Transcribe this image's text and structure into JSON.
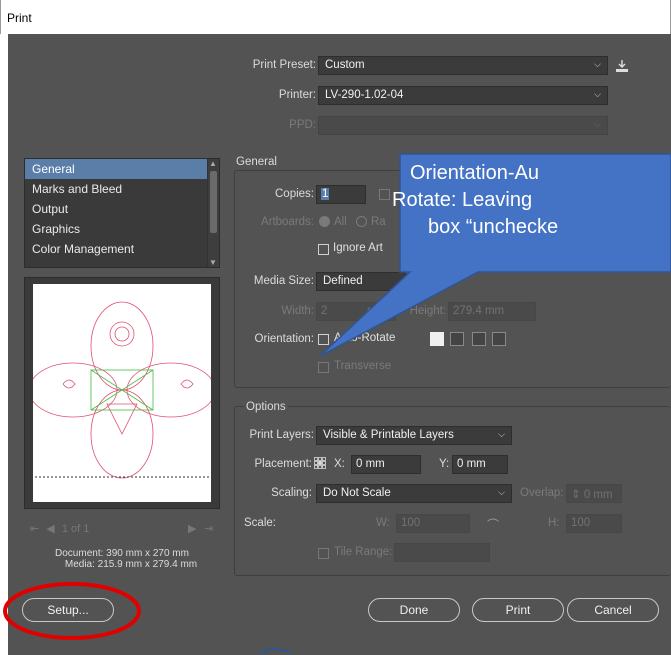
{
  "window": {
    "title": "Print"
  },
  "print_preset": {
    "label": "Print Preset:",
    "value": "Custom"
  },
  "printer": {
    "label": "Printer:",
    "value": "LV-290-1.02-04"
  },
  "ppd": {
    "label": "PPD:",
    "value": ""
  },
  "sidebar": {
    "items": [
      {
        "label": "General"
      },
      {
        "label": "Marks and Bleed"
      },
      {
        "label": "Output"
      },
      {
        "label": "Graphics"
      },
      {
        "label": "Color Management"
      }
    ]
  },
  "general": {
    "title": "General",
    "copies_label": "Copies:",
    "copies_value": "1",
    "artboards_label": "Artboards:",
    "all_label": "All",
    "range_label": "Ra",
    "ignore_label": "Ignore Art",
    "media_size_label": "Media Size:",
    "media_size_value": "Defined",
    "width_label": "Width:",
    "width_value": "2",
    "width_unit": "mm",
    "height_label": "Height:",
    "height_value": "279.4 mm",
    "orientation_label": "Orientation:",
    "auto_rotate_label": "Auto-Rotate",
    "transverse_label": "Transverse"
  },
  "options": {
    "title": "Options",
    "print_layers_label": "Print Layers:",
    "print_layers_value": "Visible & Printable Layers",
    "placement_label": "Placement:",
    "x_label": "X:",
    "x_value": "0 mm",
    "y_label": "Y:",
    "y_value": "0 mm",
    "scaling_label": "Scaling:",
    "scaling_value": "Do Not Scale",
    "overlap_label": "Overlap:",
    "overlap_value": "0 mm",
    "scale_label": "Scale:",
    "w_label": "W:",
    "w_value": "100",
    "h_label": "H:",
    "h_value": "100",
    "tile_range_label": "Tile Range:"
  },
  "preview": {
    "page_nav": "1 of 1",
    "document_label": "Document:",
    "document_value": "390 mm x 270 mm",
    "media_label": "Media:",
    "media_value": "215.9 mm x 279.4 mm"
  },
  "buttons": {
    "setup": "Setup...",
    "done": "Done",
    "print": "Print",
    "cancel": "Cancel"
  },
  "callout": {
    "lines": [
      "Orientation-Au",
      "Rotate: Leaving",
      "box “unchecke"
    ],
    "fill_color": "#4472c4"
  },
  "highlight": {
    "color": "#e00000"
  }
}
